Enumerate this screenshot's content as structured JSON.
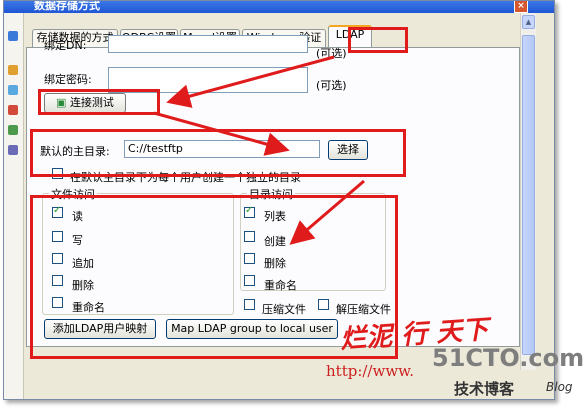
{
  "window": {
    "title": "数据存储方式",
    "close_glyph": "×"
  },
  "tabs": [
    {
      "label": "存储数据的方式"
    },
    {
      "label": "ODBC设置"
    },
    {
      "label": "Mysql设置"
    },
    {
      "label": "Windows 验证"
    },
    {
      "label": "LDAP"
    }
  ],
  "form": {
    "bind_dn_label": "绑定DN:",
    "bind_dn_hint": "(可选)",
    "bind_pwd_label": "绑定密码:",
    "bind_pwd_hint": "(可选)",
    "connect_button": "连接测试",
    "home_dir_label": "默认的主目录:",
    "home_dir_value": "C://testftp",
    "browse_button": "选择",
    "create_dir_label": "在默认主目录下为每个用户创建一个独立的目录"
  },
  "file_access": {
    "title": "文件访问",
    "items": [
      {
        "label": "读",
        "checked": true
      },
      {
        "label": "写",
        "checked": false
      },
      {
        "label": "追加",
        "checked": false
      },
      {
        "label": "删除",
        "checked": false
      },
      {
        "label": "重命名",
        "checked": false
      }
    ]
  },
  "dir_access": {
    "title": "目录访问",
    "items": [
      {
        "label": "列表",
        "checked": true
      },
      {
        "label": "创建",
        "checked": false
      },
      {
        "label": "删除",
        "checked": false
      },
      {
        "label": "重命名",
        "checked": false
      }
    ],
    "compress_label": "压缩文件",
    "decompress_label": "解压缩文件"
  },
  "actions": {
    "add_mapping_button": "添加LDAP用户映射",
    "map_group_button": "Map LDAP group to local user"
  },
  "watermark": {
    "calligraphy": "烂泥 行 天下",
    "url": "http://www.",
    "site": "51CTO.com",
    "blog_cn": "技术博客",
    "blog_en": "Blog"
  },
  "colors": {
    "annotation_red": "#e01b1b",
    "tab_highlight": "#f4a623",
    "xp_blue": "#1f56d6"
  }
}
